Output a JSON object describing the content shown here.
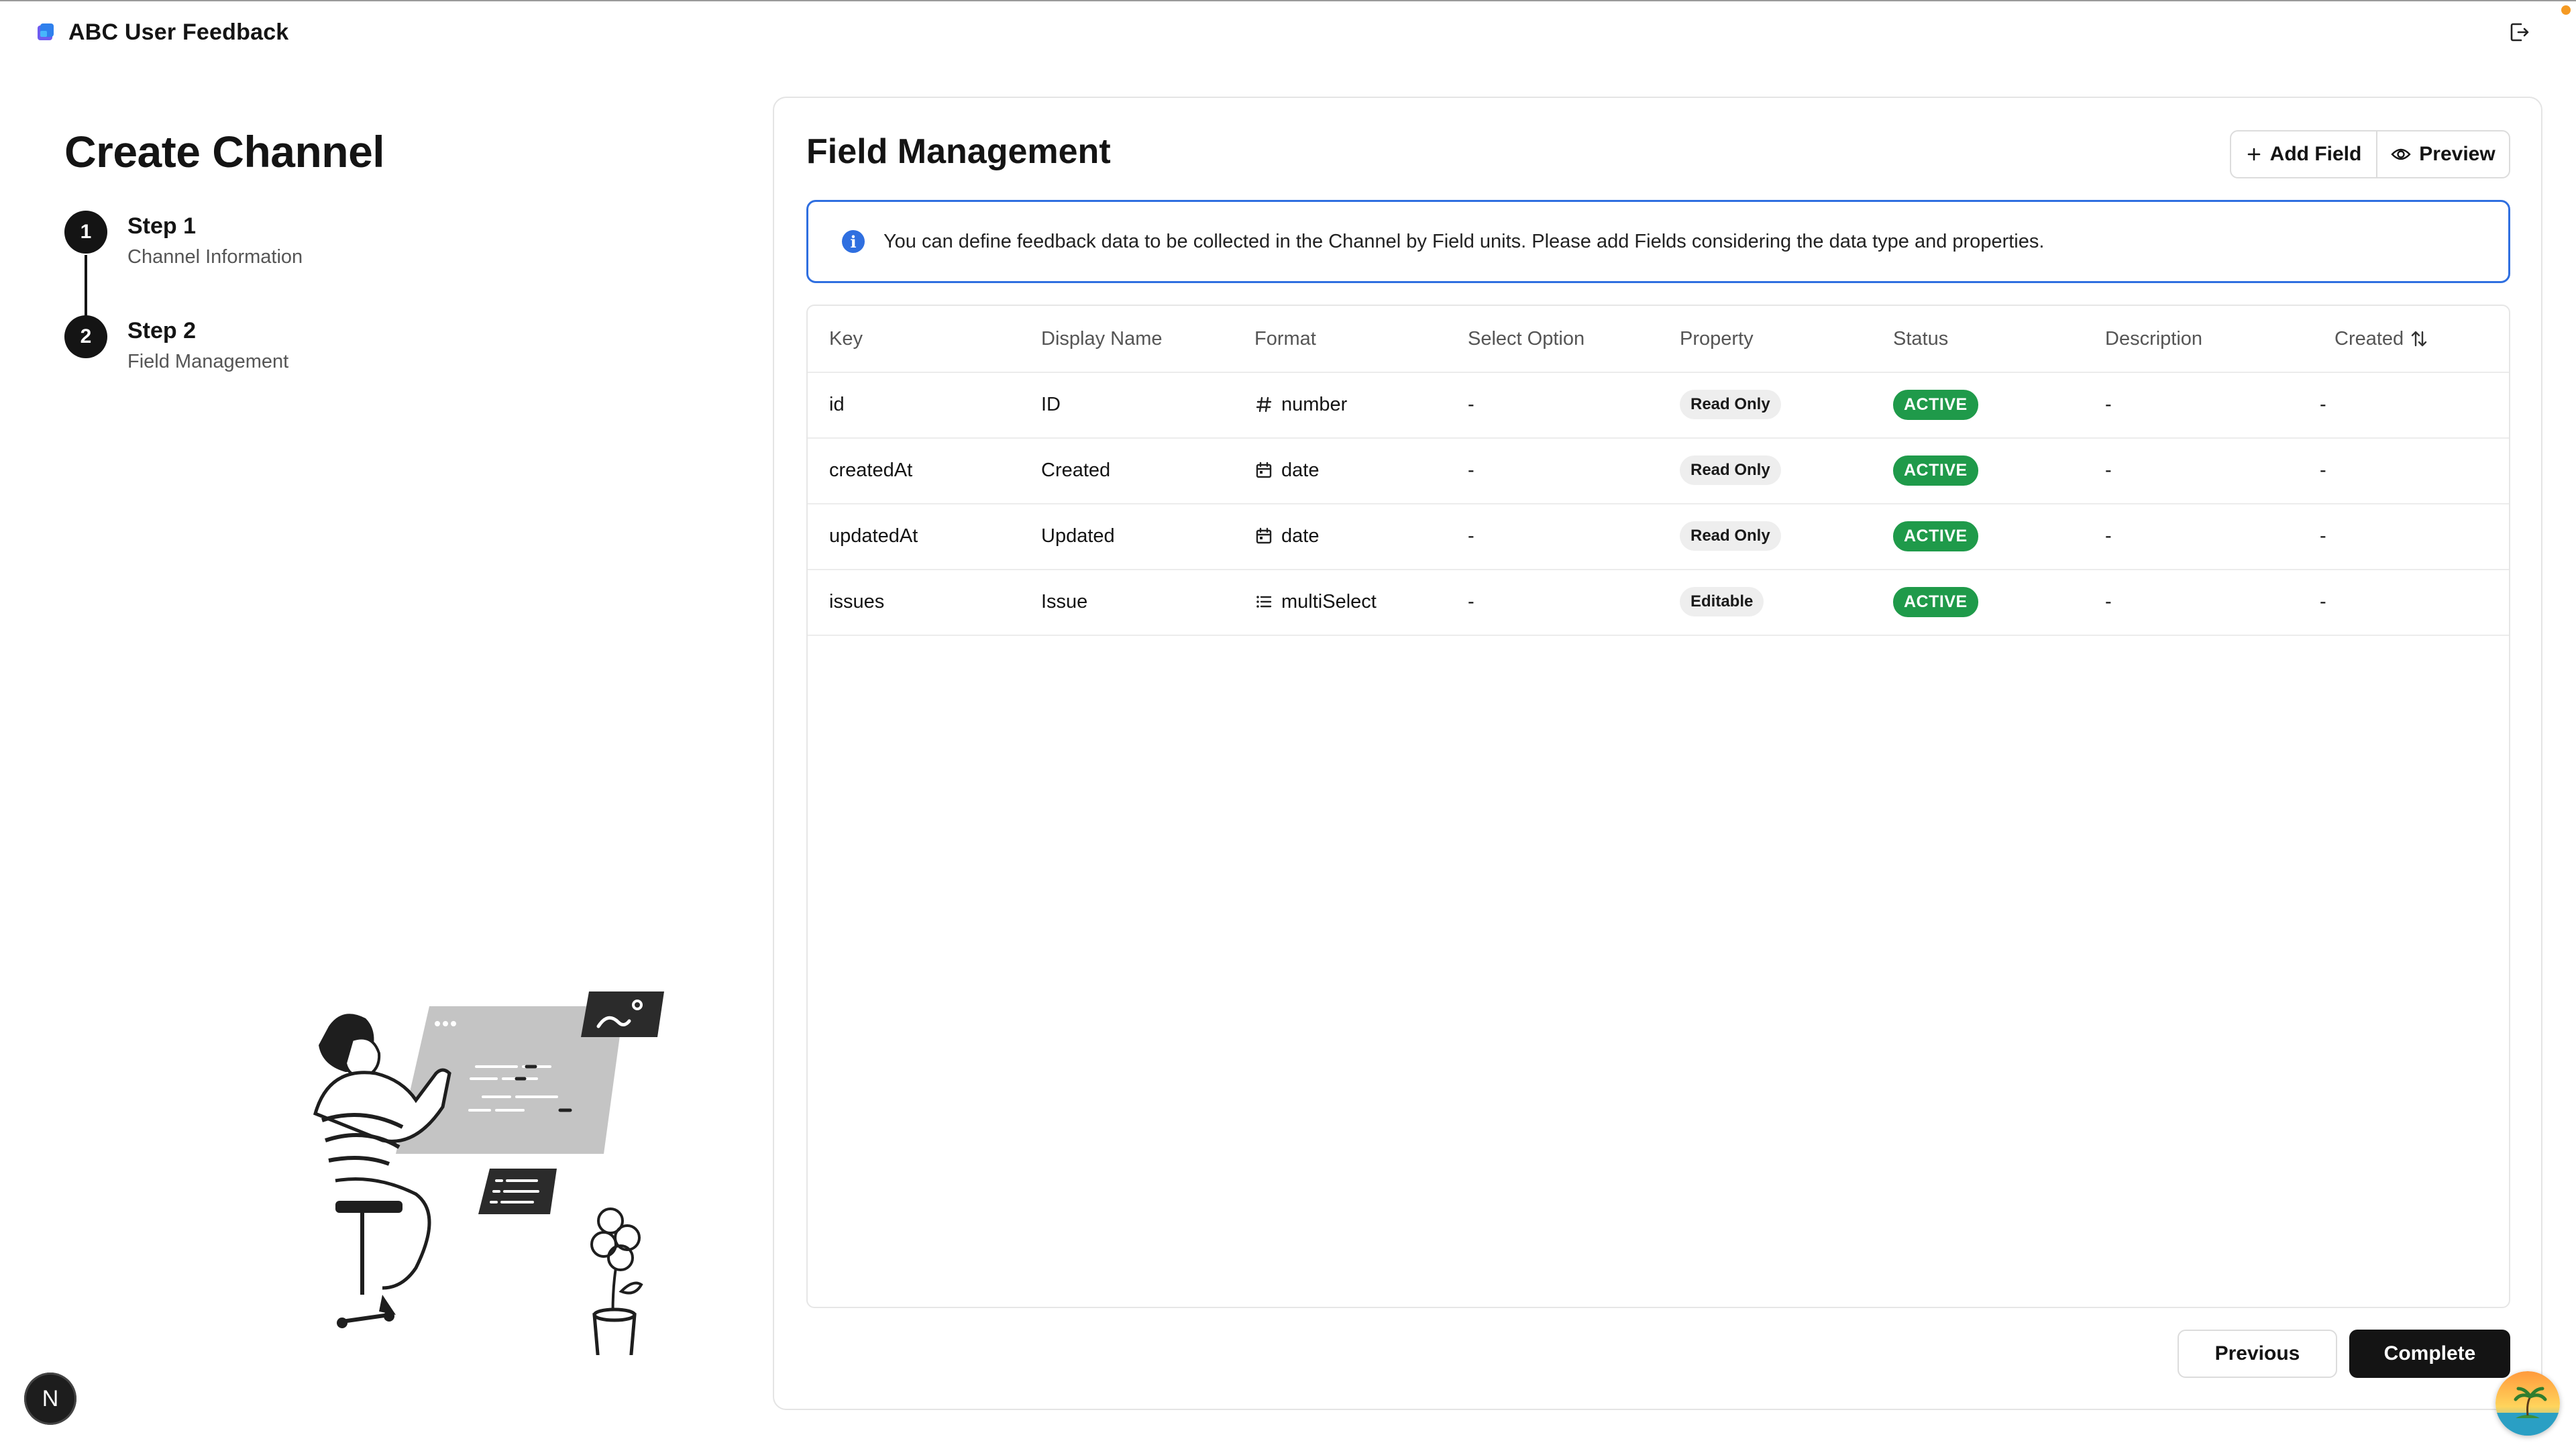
{
  "app": {
    "name": "ABC User Feedback"
  },
  "left": {
    "title": "Create Channel",
    "steps": [
      {
        "number": "1",
        "title": "Step 1",
        "subtitle": "Channel Information"
      },
      {
        "number": "2",
        "title": "Step 2",
        "subtitle": "Field Management"
      }
    ]
  },
  "badge": {
    "letter": "N"
  },
  "main": {
    "title": "Field Management",
    "add_field_label": "Add Field",
    "preview_label": "Preview",
    "info_icon_glyph": "i",
    "info_text": "You can define feedback data to be collected in the Channel by Field units. Please add Fields considering the data type and properties."
  },
  "table": {
    "columns": [
      "Key",
      "Display Name",
      "Format",
      "Select Option",
      "Property",
      "Status",
      "Description",
      "Created"
    ],
    "rows": [
      {
        "key": "id",
        "display_name": "ID",
        "format": "number",
        "format_icon": "hash-icon",
        "select_option": "-",
        "property": "Read Only",
        "status": "ACTIVE",
        "description": "-",
        "created": "-"
      },
      {
        "key": "createdAt",
        "display_name": "Created",
        "format": "date",
        "format_icon": "calendar-icon",
        "select_option": "-",
        "property": "Read Only",
        "status": "ACTIVE",
        "description": "-",
        "created": "-"
      },
      {
        "key": "updatedAt",
        "display_name": "Updated",
        "format": "date",
        "format_icon": "calendar-icon",
        "select_option": "-",
        "property": "Read Only",
        "status": "ACTIVE",
        "description": "-",
        "created": "-"
      },
      {
        "key": "issues",
        "display_name": "Issue",
        "format": "multiSelect",
        "format_icon": "list-icon",
        "select_option": "-",
        "property": "Editable",
        "status": "ACTIVE",
        "description": "-",
        "created": "-"
      }
    ]
  },
  "footer": {
    "previous_label": "Previous",
    "complete_label": "Complete"
  },
  "colors": {
    "accent_blue": "#2f6fe0",
    "status_green": "#1f9a4a",
    "primary_dark": "#141414"
  }
}
